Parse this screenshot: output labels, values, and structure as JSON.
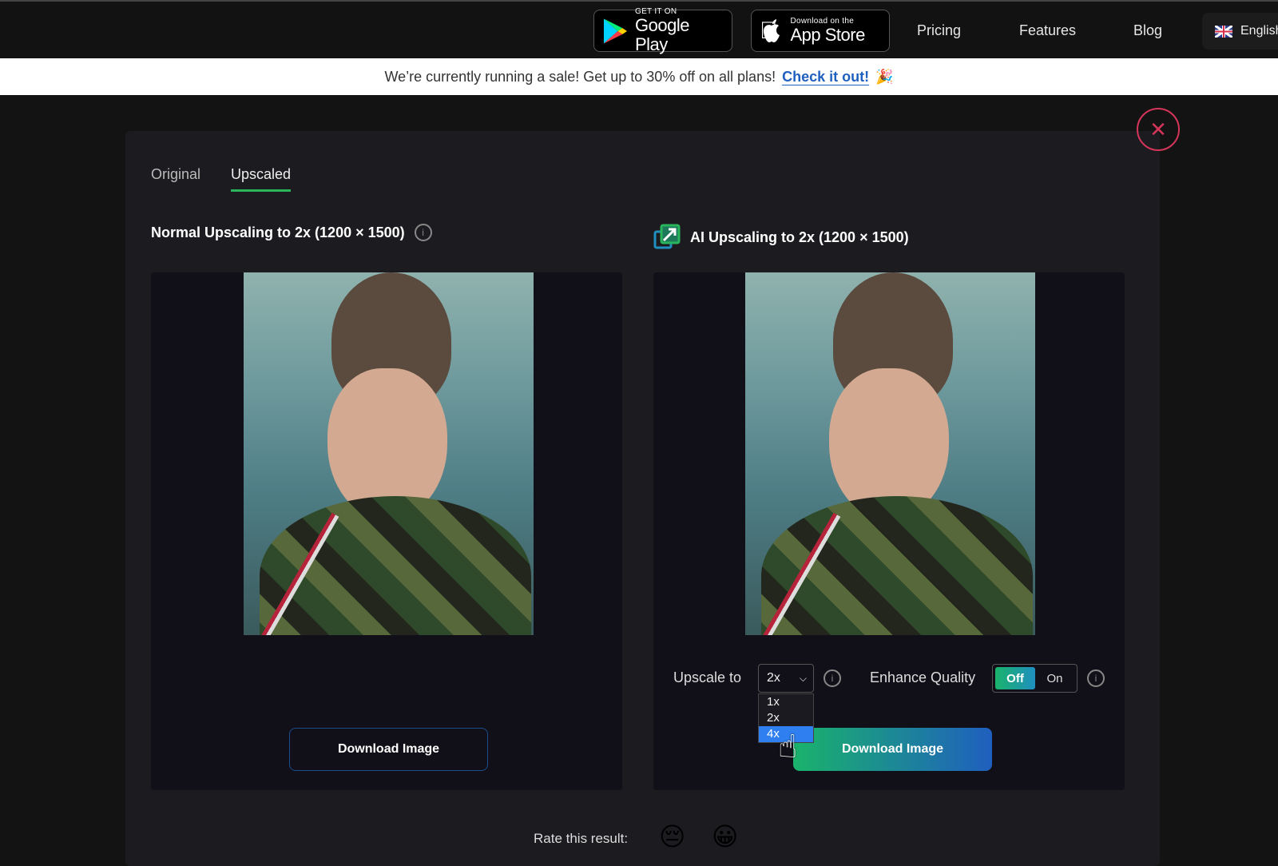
{
  "header": {
    "google_play": {
      "small": "GET IT ON",
      "big": "Google Play"
    },
    "app_store": {
      "small": "Download on the",
      "big": "App Store"
    },
    "nav": [
      "Pricing",
      "Features",
      "Blog"
    ],
    "language": "English"
  },
  "banner": {
    "text": "We’re currently running a sale! Get up to 30% off on all plans!",
    "link": "Check it out!",
    "emoji": "🎉"
  },
  "tabs": [
    {
      "label": "Original",
      "active": false
    },
    {
      "label": "Upscaled",
      "active": true
    }
  ],
  "left": {
    "title": "Normal Upscaling to 2x (1200 × 1500)",
    "download_label": "Download Image"
  },
  "right": {
    "title": "AI Upscaling to 2x (1200 × 1500)",
    "upscale_label": "Upscale to",
    "upscale_value": "2x",
    "upscale_options": [
      "1x",
      "2x",
      "4x"
    ],
    "highlighted_option": "4x",
    "enhance_label": "Enhance Quality",
    "toggle_off": "Off",
    "toggle_on": "On",
    "toggle_state": "Off",
    "download_label": "Download Image"
  },
  "rating": {
    "label": "Rate this result:",
    "bad": "😔",
    "good": "😀"
  },
  "colors": {
    "accent_green": "#2ab55c",
    "accent_blue": "#1f5fbf",
    "close_red": "#d6355a",
    "selected_option": "#2f7ff0"
  }
}
